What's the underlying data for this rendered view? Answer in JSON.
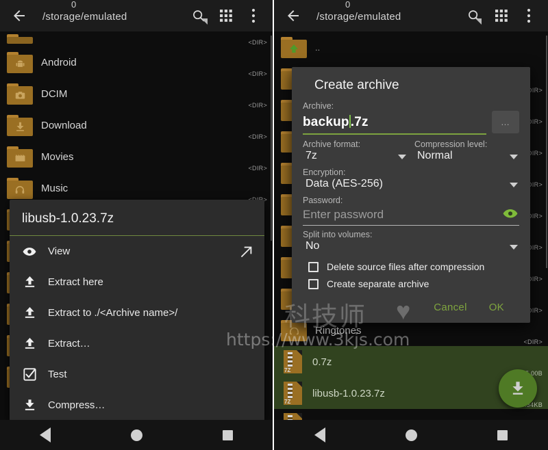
{
  "left_panel": {
    "appbar": {
      "back_icon": "arrow-left-icon",
      "volume_label": "0",
      "path": "/storage/emulated",
      "search_icon": "search-icon",
      "grid_icon": "grid-apps-icon",
      "overflow_icon": "more-vertical-icon"
    },
    "files": [
      {
        "name": "",
        "meta": "<DIR>",
        "icon": "folder-partial",
        "glyph": "",
        "selected": false
      },
      {
        "name": "Android",
        "meta": "<DIR>",
        "icon": "folder-android",
        "glyph": "⚙",
        "selected": false
      },
      {
        "name": "DCIM",
        "meta": "<DIR>",
        "icon": "folder-camera",
        "glyph": "■",
        "selected": false
      },
      {
        "name": "Download",
        "meta": "<DIR>",
        "icon": "folder-download",
        "glyph": "↓",
        "selected": false
      },
      {
        "name": "Movies",
        "meta": "<DIR>",
        "icon": "folder-movies",
        "glyph": "▶",
        "selected": false
      },
      {
        "name": "Music",
        "meta": "<DIR>",
        "icon": "folder-music",
        "glyph": "♫",
        "selected": false
      }
    ],
    "popup_menu": {
      "title": "libusb-1.0.23.7z",
      "items": [
        {
          "label": "View",
          "icon": "eye-icon",
          "right_icon": "arrow-up-right-icon"
        },
        {
          "label": "Extract here",
          "icon": "extract-up-icon",
          "right_icon": ""
        },
        {
          "label": "Extract to ./<Archive name>/",
          "icon": "extract-up-icon",
          "right_icon": ""
        },
        {
          "label": "Extract…",
          "icon": "extract-up-icon",
          "right_icon": ""
        },
        {
          "label": "Test",
          "icon": "checkbox-check-icon",
          "right_icon": ""
        },
        {
          "label": "Compress…",
          "icon": "compress-down-icon",
          "right_icon": ""
        }
      ]
    },
    "navbar": {
      "back": "nav-back-icon",
      "home": "nav-home-icon",
      "recents": "nav-recents-icon"
    }
  },
  "right_panel": {
    "appbar": {
      "back_icon": "arrow-left-icon",
      "volume_label": "0",
      "path": "/storage/emulated",
      "search_icon": "search-icon",
      "grid_icon": "grid-apps-icon",
      "overflow_icon": "more-vertical-icon"
    },
    "files": [
      {
        "name": "..",
        "meta": "",
        "icon": "folder-parent",
        "glyph": "↑",
        "selected": false
      },
      {
        "name": "",
        "meta": "<DIR>",
        "icon": "folder",
        "glyph": "",
        "selected": false
      },
      {
        "name": "",
        "meta": "<DIR>",
        "icon": "folder",
        "glyph": "",
        "selected": false
      },
      {
        "name": "",
        "meta": "<DIR>",
        "icon": "folder",
        "glyph": "",
        "selected": false
      },
      {
        "name": "",
        "meta": "<DIR>",
        "icon": "folder",
        "glyph": "",
        "selected": false
      },
      {
        "name": "",
        "meta": "<DIR>",
        "icon": "folder",
        "glyph": "",
        "selected": false
      },
      {
        "name": "",
        "meta": "<DIR>",
        "icon": "folder",
        "glyph": "",
        "selected": false
      },
      {
        "name": "",
        "meta": "<DIR>",
        "icon": "folder",
        "glyph": "",
        "selected": false
      },
      {
        "name": "",
        "meta": "<DIR>",
        "icon": "folder",
        "glyph": "",
        "selected": false
      },
      {
        "name": "Ringtones",
        "meta": "<DIR>",
        "icon": "folder-ringtones",
        "glyph": "♪",
        "selected": false
      }
    ],
    "selected_files": [
      {
        "name": "0.7z",
        "meta": "275.00B",
        "icon": "archive-7z",
        "tag": "7Z"
      },
      {
        "name": "libusb-1.0.23.7z",
        "meta": "970.34KB",
        "icon": "archive-7z",
        "tag": "7Z"
      }
    ],
    "fab": {
      "icon": "download-arrow-icon"
    },
    "navbar": {
      "back": "nav-back-icon",
      "home": "nav-home-icon",
      "recents": "nav-recents-icon"
    },
    "dialog": {
      "title": "Create archive",
      "archive_label": "Archive:",
      "archive_value_before_caret": "backup",
      "archive_value_after_caret": ".7z",
      "browse_button": "…",
      "archive_format_label": "Archive format:",
      "archive_format_value": "7z",
      "compression_level_label": "Compression level:",
      "compression_level_value": "Normal",
      "encryption_label": "Encryption:",
      "encryption_value": "Data (AES-256)",
      "password_label": "Password:",
      "password_placeholder": "Enter password",
      "password_toggle_icon": "eye-icon",
      "split_label": "Split into volumes:",
      "split_value": "No",
      "checkbox_delete_source": "Delete source files after compression",
      "checkbox_separate_archive": "Create separate archive",
      "cancel_label": "Cancel",
      "ok_label": "OK"
    }
  },
  "watermark": {
    "chinese": "科技师",
    "heart": "♥",
    "url": "https://www.3kjs.com"
  },
  "colors": {
    "accent_green": "#7da33f",
    "selection_green": "#31431f",
    "folder_amber": "#9a6f23",
    "dialog_bg": "#3b3b3b",
    "popup_bg": "#2c2c2c",
    "app_bg": "#0d0d0d"
  }
}
